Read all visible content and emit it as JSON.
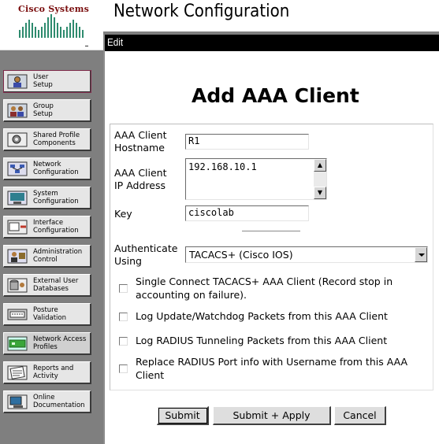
{
  "brand": {
    "name": "Cisco Systems"
  },
  "page": {
    "title": "Network Configuration",
    "frame_title": "Edit"
  },
  "nav": [
    {
      "lines": [
        "User",
        "Setup"
      ],
      "icon": "user-icon"
    },
    {
      "lines": [
        "Group",
        "Setup"
      ],
      "icon": "group-icon"
    },
    {
      "lines": [
        "Shared Profile",
        "Components"
      ],
      "icon": "shared-profile-icon"
    },
    {
      "lines": [
        "Network",
        "Configuration"
      ],
      "icon": "network-icon"
    },
    {
      "lines": [
        "System",
        "Configuration"
      ],
      "icon": "system-icon"
    },
    {
      "lines": [
        "Interface",
        "Configuration"
      ],
      "icon": "interface-icon"
    },
    {
      "lines": [
        "Administration",
        "Control"
      ],
      "icon": "administration-icon"
    },
    {
      "lines": [
        "External User",
        "Databases"
      ],
      "icon": "database-icon"
    },
    {
      "lines": [
        "Posture",
        "Validation"
      ],
      "icon": "posture-icon"
    },
    {
      "lines": [
        "Network Access",
        "Profiles"
      ],
      "icon": "network-access-icon"
    },
    {
      "lines": [
        "Reports and",
        "Activity"
      ],
      "icon": "reports-icon"
    },
    {
      "lines": [
        "Online",
        "Documentation"
      ],
      "icon": "documentation-icon"
    }
  ],
  "form": {
    "heading": "Add AAA Client",
    "hostname_label_1": "AAA Client",
    "hostname_label_2": "Hostname",
    "hostname_value": "R1",
    "ip_label_1": "AAA Client",
    "ip_label_2": "IP Address",
    "ip_value": "192.168.10.1",
    "key_label": "Key",
    "key_value": "ciscolab",
    "auth_label_1": "Authenticate",
    "auth_label_2": "Using",
    "auth_value": "TACACS+ (Cisco IOS)",
    "checkboxes": [
      {
        "text": "Single Connect TACACS+ AAA Client (Record stop in accounting on failure).",
        "checked": false
      },
      {
        "text": "Log Update/Watchdog Packets from this AAA Client",
        "checked": false
      },
      {
        "text": "Log RADIUS Tunneling Packets from this AAA Client",
        "checked": false
      },
      {
        "text": "Replace RADIUS Port info with Username from this AAA Client",
        "checked": false
      }
    ]
  },
  "buttons": {
    "submit": "Submit",
    "submit_apply": "Submit + Apply",
    "cancel": "Cancel"
  }
}
